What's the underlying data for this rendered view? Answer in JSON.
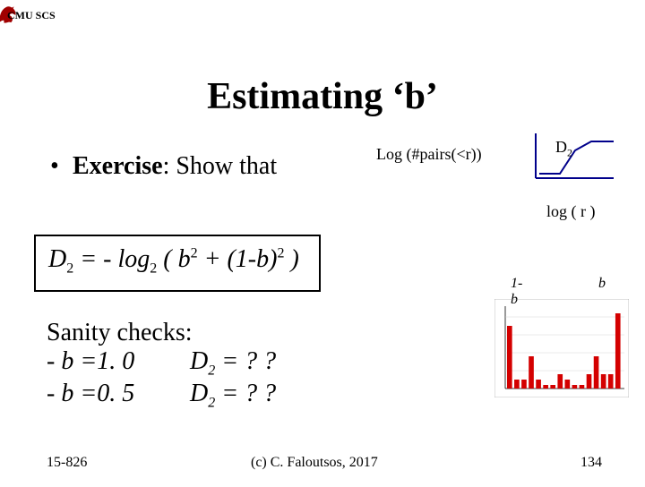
{
  "header": {
    "org": "CMU SCS"
  },
  "title": "Estimating ‘b’",
  "exercise": {
    "bullet": "•",
    "label_bold": "Exercise",
    "label_rest": ": Show that"
  },
  "chart1": {
    "ylabel": "Log (#pairs(<r))",
    "curve_label": "D",
    "curve_label_sub": "2",
    "xlabel": "log ( r )"
  },
  "formula": {
    "lhs_var": "D",
    "lhs_sub": "2",
    "eq": " = - ",
    "log": "log",
    "log_sub": "2",
    "open": " (  ",
    "b": "b",
    "sq1": "2",
    "plus": " + (1-b)",
    "sq2": "2",
    "close": " )"
  },
  "sanity": {
    "heading": "Sanity checks:",
    "row1_l": "-  b =1. 0",
    "row1_r_var": "D",
    "row1_r_sub": "2",
    "row1_r_rest": " = ? ?",
    "row2_l": "-  b =0. 5",
    "row2_r_var": "D",
    "row2_r_sub": "2",
    "row2_r_rest": " = ? ?"
  },
  "bars": {
    "label_left": "1-b",
    "label_right": "b"
  },
  "footer": {
    "left": "15-826",
    "mid": "(c) C. Faloutsos, 2017",
    "right": "134"
  },
  "chart_data": [
    {
      "type": "line",
      "title": "D2 curve",
      "xlabel": "log(r)",
      "ylabel": "log(#pairs(<r))",
      "x": [
        0,
        0.35,
        0.55,
        0.8,
        1.0
      ],
      "y": [
        0.15,
        0.15,
        0.55,
        0.7,
        0.7
      ],
      "xlim": [
        0,
        1
      ],
      "ylim": [
        0,
        1
      ]
    },
    {
      "type": "bar",
      "title": "Cantor-like density",
      "categories": [
        "0",
        "1",
        "2",
        "3",
        "4",
        "5",
        "6",
        "7",
        "8",
        "9",
        "10",
        "11",
        "12",
        "13",
        "14",
        "15"
      ],
      "values": [
        35,
        5,
        5,
        18,
        5,
        2,
        2,
        8,
        5,
        2,
        2,
        8,
        18,
        8,
        8,
        42
      ],
      "ylim": [
        0,
        45
      ],
      "annotations": [
        "1-b",
        "b"
      ]
    }
  ]
}
